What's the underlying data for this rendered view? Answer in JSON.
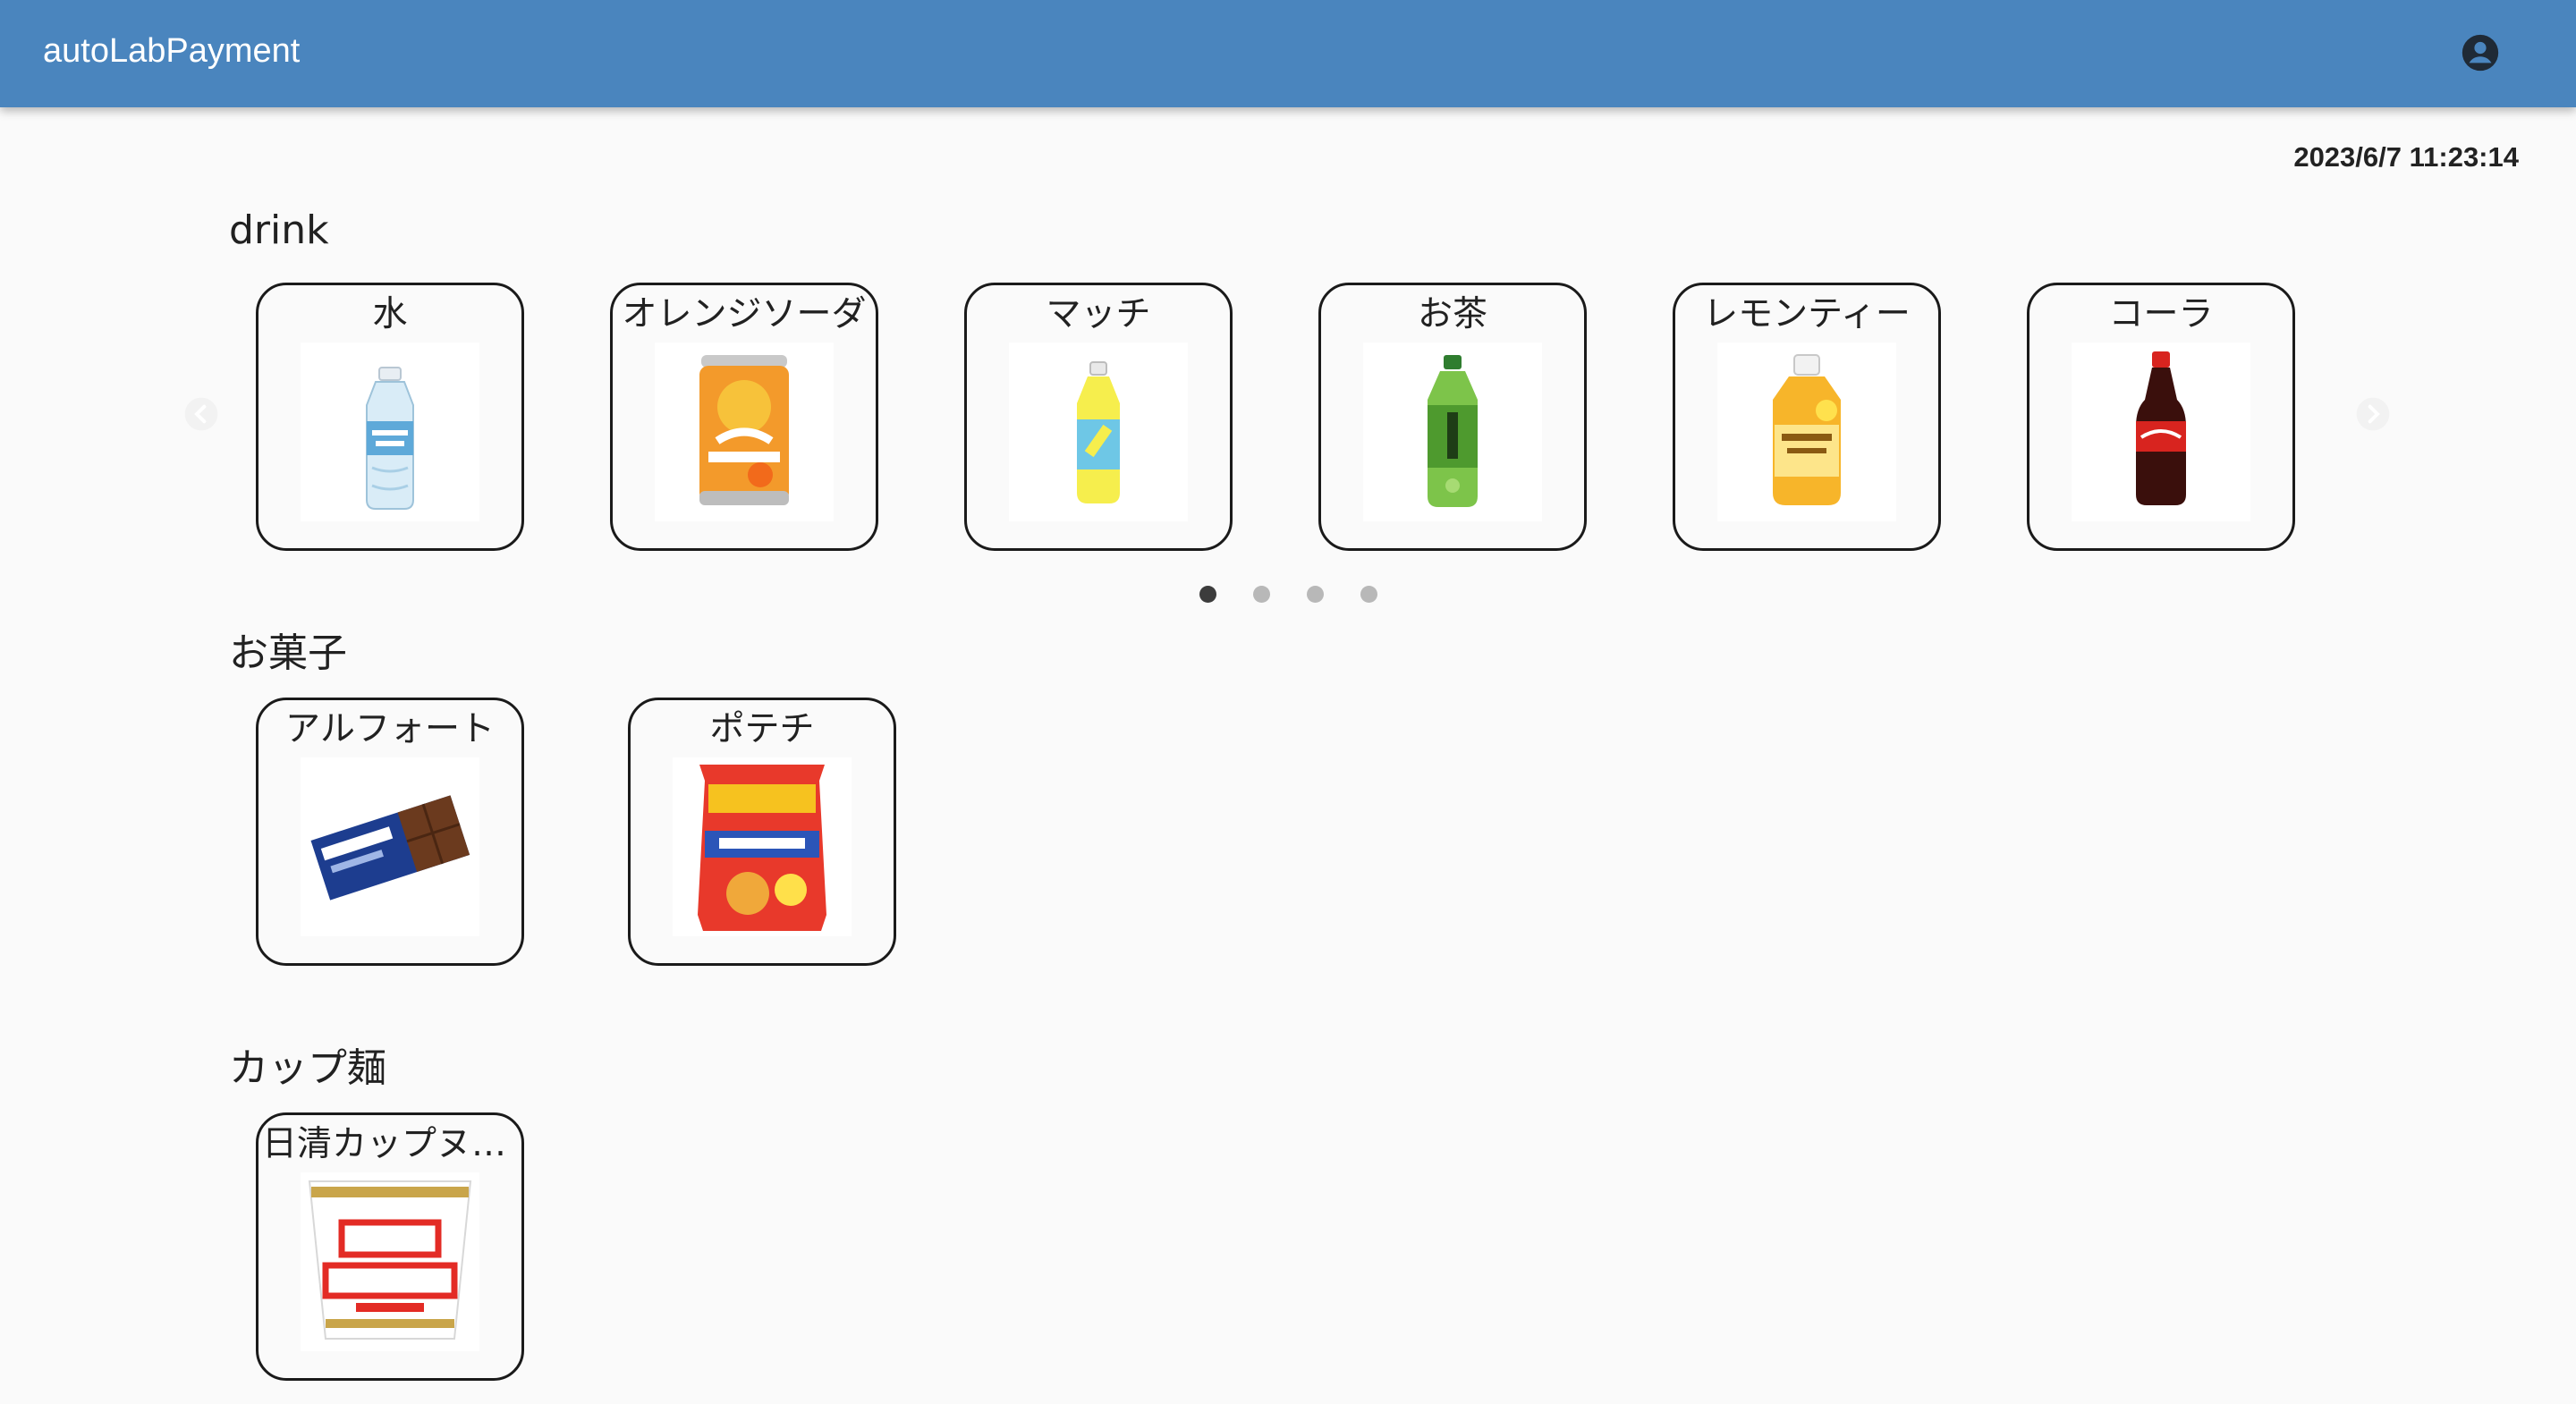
{
  "app": {
    "title": "autoLabPayment"
  },
  "clock": "2023/6/7 11:23:14",
  "categories": {
    "drink": {
      "title": "drink",
      "items": [
        {
          "label": "水",
          "icon": "water-bottle-icon"
        },
        {
          "label": "オレンジソーダ",
          "icon": "orange-soda-can-icon"
        },
        {
          "label": "マッチ",
          "icon": "match-soda-bottle-icon"
        },
        {
          "label": "お茶",
          "icon": "green-tea-bottle-icon"
        },
        {
          "label": "レモンティー",
          "icon": "lemon-tea-bottle-icon"
        },
        {
          "label": "コーラ",
          "icon": "cola-bottle-icon"
        }
      ]
    },
    "snack": {
      "title": "お菓子",
      "items": [
        {
          "label": "アルフォート",
          "icon": "alfort-chocolate-box-icon"
        },
        {
          "label": "ポテチ",
          "icon": "potato-chips-bag-icon"
        }
      ]
    },
    "noodle": {
      "title": "カップ麺",
      "items": [
        {
          "label": "日清カップヌードル",
          "icon": "cup-noodle-icon"
        }
      ]
    }
  },
  "carousel": {
    "page_count": 4,
    "active_page": 1
  },
  "colors": {
    "appbar": "#4a85be",
    "background": "#fafafa",
    "dot_active": "#3c3c3c",
    "dot_inactive": "#b8b8b8"
  }
}
